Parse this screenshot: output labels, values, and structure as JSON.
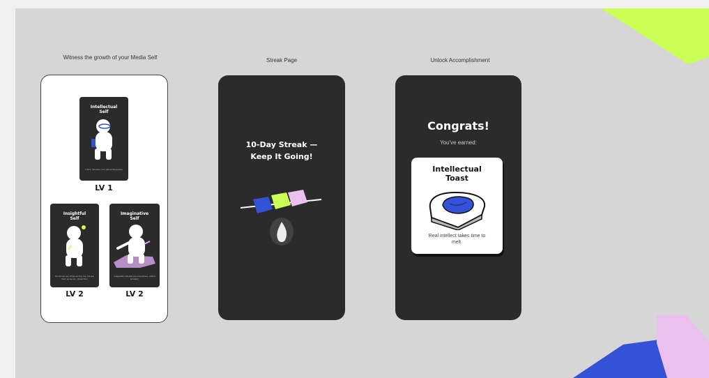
{
  "sections": {
    "growth_label": "Witness the growth of your Media Self",
    "streak_label": "Streak Page",
    "unlock_label": "Unlock Accomplishment"
  },
  "growth": {
    "cards": [
      {
        "title": "Intellectual Self",
        "quote": "I think, therefore I am. (René Descartes)",
        "level": "LV 1"
      },
      {
        "title": "Insightful Self",
        "quote": "Not all can see things as they are, but see them as we are. (Anaïs Nin)",
        "level": "LV 2"
      },
      {
        "title": "Imaginative Self",
        "quote": "Imagination will take you everywhere. (Albert Einstein)",
        "level": "LV 2"
      }
    ]
  },
  "streak": {
    "title": "10-Day Streak — Keep It Going!"
  },
  "unlock": {
    "title": "Congrats!",
    "subtitle": "You've earned:",
    "badge_title": "Intellectual Toast",
    "badge_caption": "Real intellect takes time to melt."
  },
  "colors": {
    "background": "#d6d6d6",
    "phone_dark": "#2b2b2b",
    "lime": "#ccff55",
    "blue": "#3452d6",
    "pink": "#ecc0ee",
    "lilac": "#d9a8f0"
  },
  "icons": [
    "mascot-figure",
    "skewer-cubes",
    "flame",
    "toast-with-butter"
  ]
}
